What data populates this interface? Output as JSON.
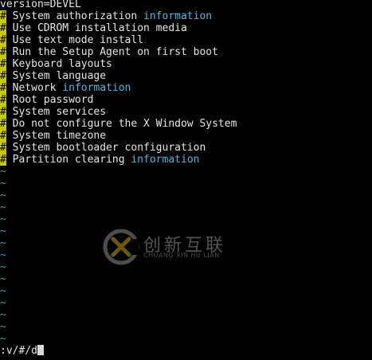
{
  "editor": {
    "first_line": "version=DEVEL",
    "hash": "#",
    "comment_lines": [
      {
        "before": " System authorization ",
        "keyword": "information"
      },
      {
        "before": " Use CDROM installation media",
        "keyword": ""
      },
      {
        "before": " Use text mode install",
        "keyword": ""
      },
      {
        "before": " Run the Setup Agent on first boot",
        "keyword": ""
      },
      {
        "before": " Keyboard layouts",
        "keyword": ""
      },
      {
        "before": " System language",
        "keyword": ""
      },
      {
        "before": " Network ",
        "keyword": "information"
      },
      {
        "before": " Root password",
        "keyword": ""
      },
      {
        "before": " System services",
        "keyword": ""
      },
      {
        "before": " Do not configure the X Window System",
        "keyword": ""
      },
      {
        "before": " System timezone",
        "keyword": ""
      },
      {
        "before": " System bootloader configuration",
        "keyword": ""
      },
      {
        "before": " Partition clearing ",
        "keyword": "information"
      }
    ],
    "tilde": "~",
    "tilde_count": 15,
    "command_line": ":v/#/d"
  },
  "watermark": {
    "chinese": "创新互联",
    "english": "CHUANG XIN HU LIAN"
  },
  "colors": {
    "background": "#000000",
    "text": "#e6e6e6",
    "hash_highlight": "#c8c800",
    "keyword": "#4fb8e0",
    "tilde": "#3aa0c0"
  }
}
